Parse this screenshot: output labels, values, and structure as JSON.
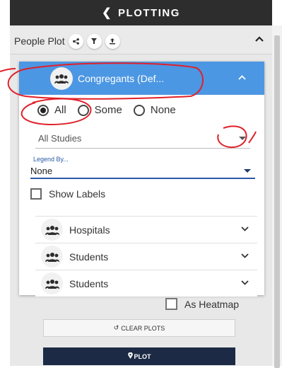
{
  "header": {
    "title": "PLOTTING",
    "back_icon": "chevron-left-icon"
  },
  "people_plot": {
    "label": "People Plot",
    "icons": [
      "share-nodes-icon",
      "filter-icon",
      "upload-icon"
    ],
    "collapse_icon": "chevron-up-icon"
  },
  "group": {
    "title": "Congregants (Def...",
    "icon": "people-group-icon",
    "expanded": true,
    "header_color": "#4c97e3",
    "radio_options": [
      {
        "label": "All",
        "checked": true
      },
      {
        "label": "Some",
        "checked": false
      },
      {
        "label": "None",
        "checked": false
      }
    ],
    "studies_select": {
      "value": "All Studies"
    },
    "legend": {
      "label": "Legend By...",
      "value": "None"
    },
    "show_labels": {
      "label": "Show Labels",
      "checked": false
    }
  },
  "sub_groups": [
    {
      "title": "Hospitals",
      "icon": "people-group-icon"
    },
    {
      "title": "Students",
      "icon": "people-group-icon"
    },
    {
      "title": "Students",
      "icon": "people-group-icon"
    }
  ],
  "heatmap": {
    "label": "As Heatmap",
    "checked": false
  },
  "clear_button": {
    "label": "CLEAR PLOTS",
    "icon": "undo-icon"
  },
  "plot_button": {
    "label": "PLOT",
    "icon": "map-pin-icon",
    "color": "#1c2a45"
  },
  "annotation_color": "#e0202a"
}
